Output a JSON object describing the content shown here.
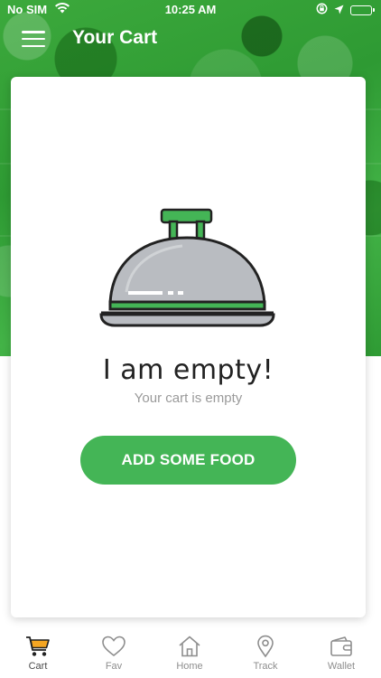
{
  "status_bar": {
    "carrier": "No SIM",
    "time": "10:25 AM"
  },
  "header": {
    "title": "Your Cart"
  },
  "empty_state": {
    "title": "I am empty!",
    "subtitle": "Your cart is empty",
    "button_label": "ADD SOME FOOD"
  },
  "tabs": [
    {
      "label": "Cart",
      "icon": "cart-icon",
      "active": true
    },
    {
      "label": "Fav",
      "icon": "heart-icon",
      "active": false
    },
    {
      "label": "Home",
      "icon": "home-icon",
      "active": false
    },
    {
      "label": "Track",
      "icon": "location-pin-icon",
      "active": false
    },
    {
      "label": "Wallet",
      "icon": "wallet-icon",
      "active": false
    }
  ],
  "colors": {
    "brand_green": "#44b556",
    "cart_icon_orange": "#f5a623",
    "cloche_grey": "#b9bcc1"
  }
}
